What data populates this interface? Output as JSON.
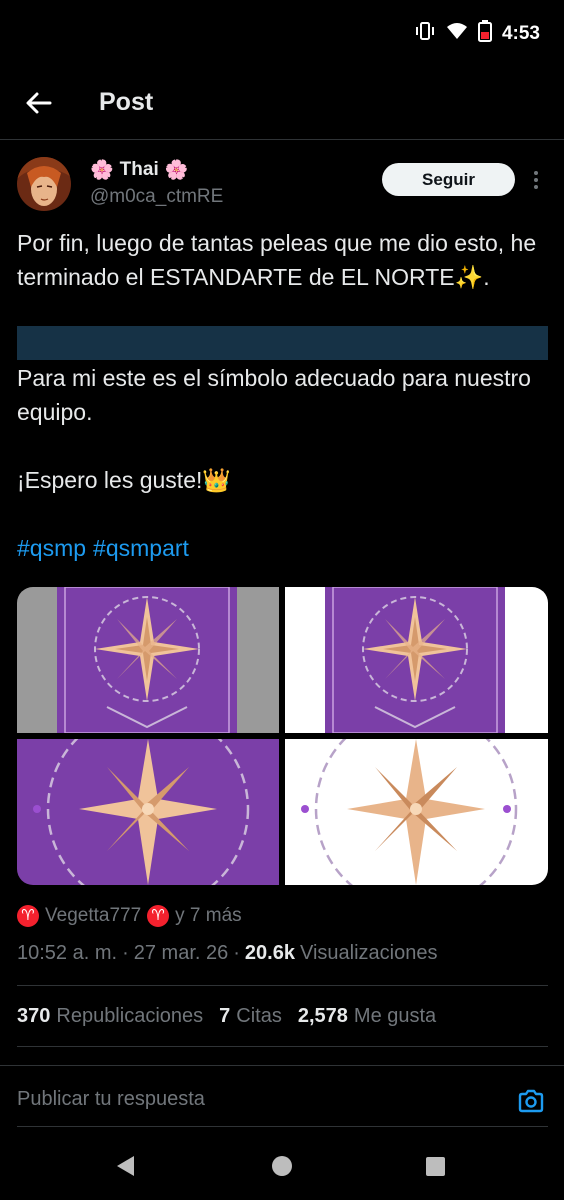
{
  "status_bar": {
    "time": "4:53",
    "icons": [
      "vibrate-icon",
      "wifi-icon",
      "battery-low-icon"
    ]
  },
  "header": {
    "title": "Post",
    "back_icon": "arrow-left-icon"
  },
  "author": {
    "name": "Thai",
    "name_emoji_left": "🌸",
    "name_emoji_right": "🌸",
    "handle": "@m0ca_ctmRE",
    "follow_label": "Seguir"
  },
  "tweet": {
    "line1": "Por fin, luego de tantas peleas que me dio esto, he terminado el ESTANDARTE de EL NORTE✨.",
    "line2": "Para mi este es el símbolo adecuado para nuestro equipo.",
    "line3": "¡Espero les guste!👑",
    "hashtags": [
      "#qsmp",
      "#qsmpart"
    ]
  },
  "reactions": {
    "user": "Vegetta777",
    "others": "y 7 más"
  },
  "meta": {
    "time": "10:52 a. m.",
    "sep1": "·",
    "date": "27 mar. 26",
    "sep2": "·",
    "views_count": "20.6k",
    "views_label": "Visualizaciones"
  },
  "stats": {
    "reposts_count": "370",
    "reposts_label": "Republicaciones",
    "quotes_count": "7",
    "quotes_label": "Citas",
    "likes_count": "2,578",
    "likes_label": "Me gusta"
  },
  "reply": {
    "placeholder": "Publicar tu respuesta"
  },
  "colors": {
    "accent": "#1d9bf0",
    "purple": "#7b3fa8",
    "gold": "#e8b48a"
  }
}
